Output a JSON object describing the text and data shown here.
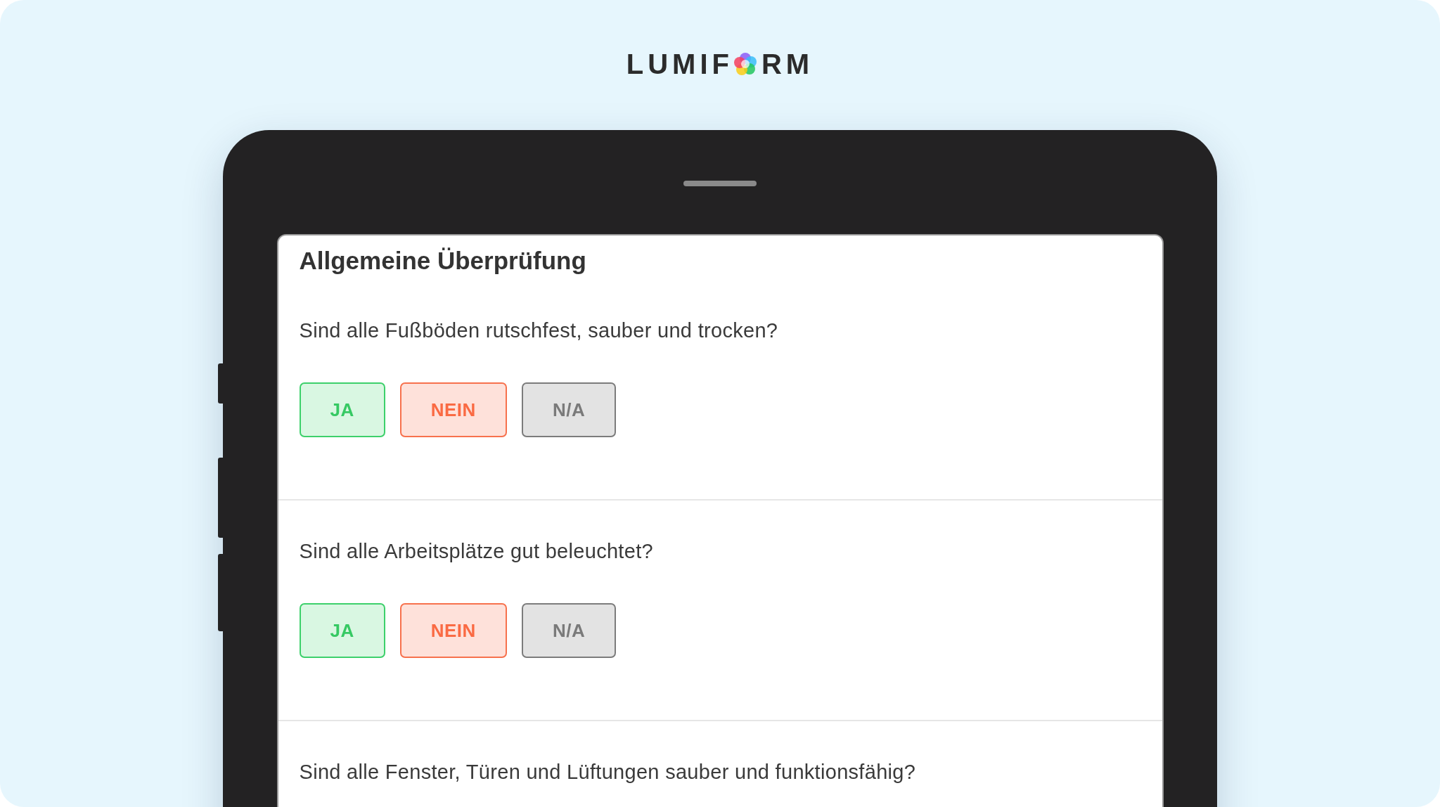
{
  "logo": {
    "text_before_icon": "LUMIF",
    "text_after_icon": "RM"
  },
  "form": {
    "title": "Allgemeine Überprüfung",
    "questions": [
      {
        "text": "Sind alle Fußböden rutschfest, sauber und trocken?",
        "answers": [
          {
            "label": "JA",
            "kind": "yes"
          },
          {
            "label": "NEIN",
            "kind": "no"
          },
          {
            "label": "N/A",
            "kind": "na"
          }
        ]
      },
      {
        "text": "Sind alle Arbeitsplätze gut beleuchtet?",
        "answers": [
          {
            "label": "JA",
            "kind": "yes"
          },
          {
            "label": "NEIN",
            "kind": "no"
          },
          {
            "label": "N/A",
            "kind": "na"
          }
        ]
      },
      {
        "text": "Sind alle Fenster, Türen und Lüftungen sauber und funktionsfähig?"
      }
    ]
  }
}
